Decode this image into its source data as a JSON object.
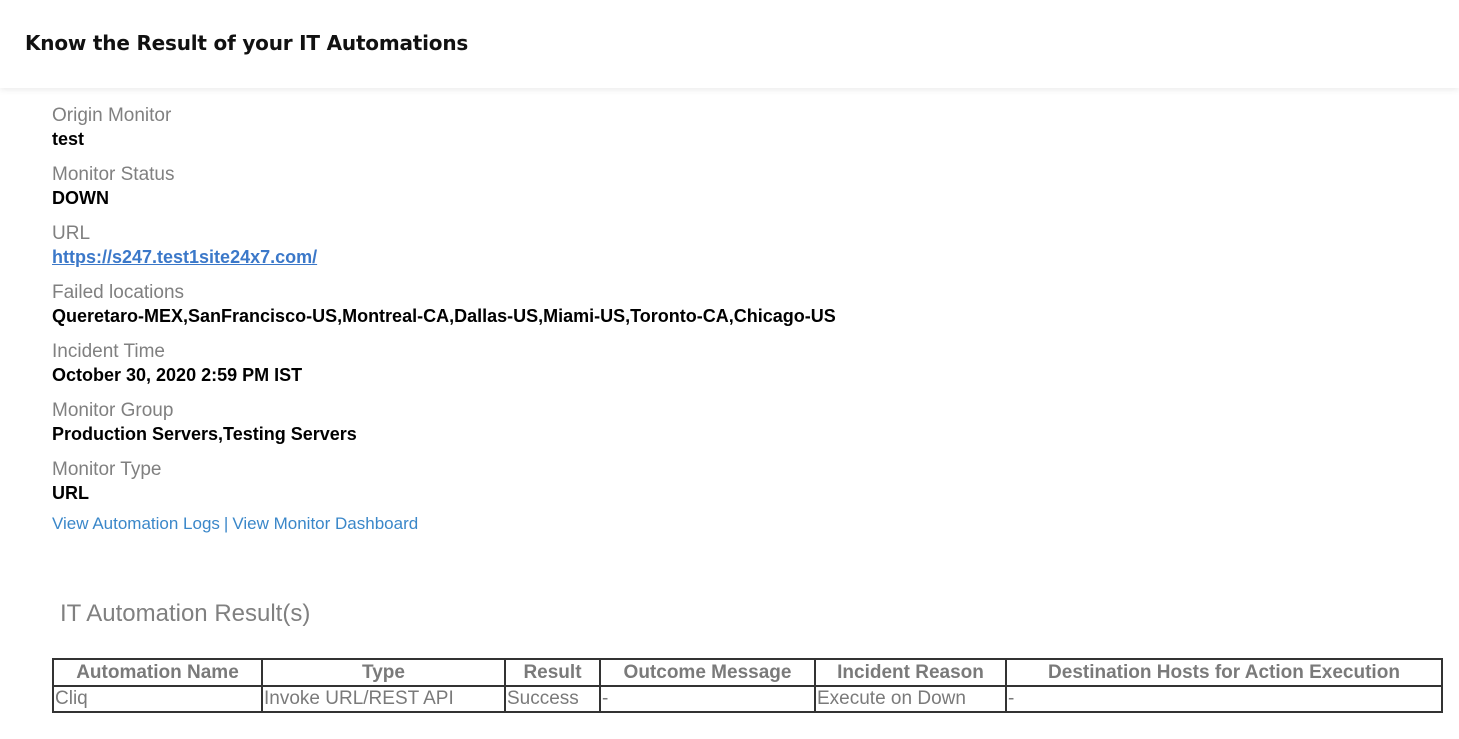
{
  "header": {
    "title": "Know the Result of your IT Automations"
  },
  "fields": [
    {
      "label": "Origin Monitor",
      "value": "test"
    },
    {
      "label": "Monitor Status",
      "value": "DOWN"
    },
    {
      "label": "URL",
      "value": "https://s247.test1site24x7.com/"
    },
    {
      "label": "Failed locations",
      "value": "Queretaro-MEX,SanFrancisco-US,Montreal-CA,Dallas-US,Miami-US,Toronto-CA,Chicago-US"
    },
    {
      "label": "Incident Time",
      "value": "October 30, 2020 2:59 PM IST"
    },
    {
      "label": "Monitor Group",
      "value": "Production Servers,Testing Servers"
    },
    {
      "label": "Monitor Type",
      "value": "URL"
    }
  ],
  "links": {
    "automation_logs": "View Automation Logs",
    "separator": "|",
    "monitor_dashboard": "View Monitor Dashboard"
  },
  "results": {
    "title": "IT Automation Result(s)",
    "columns": [
      "Automation Name",
      "Type",
      "Result",
      "Outcome Message",
      "Incident Reason",
      "Destination Hosts for Action Execution"
    ],
    "rows": [
      [
        "Cliq",
        "Invoke URL/REST API",
        "Success",
        "-",
        "Execute on Down",
        "-"
      ]
    ]
  },
  "colors": {
    "label": "#808080",
    "link": "#3a87c9",
    "url_link": "#3b78c9",
    "value": "#000000",
    "table_border": "#333333"
  }
}
